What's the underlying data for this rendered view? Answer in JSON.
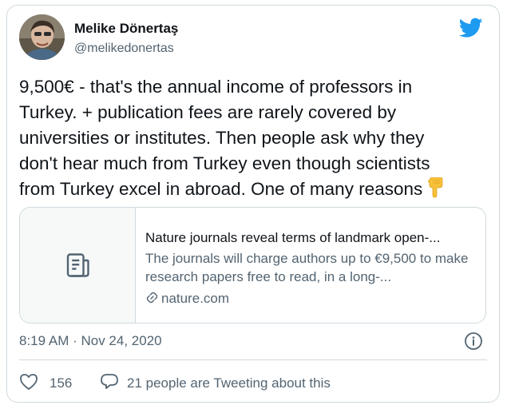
{
  "author": {
    "name": "Melike Dönertaş",
    "handle": "@melikedonertas"
  },
  "tweet": {
    "text": "9,500€ - that's the annual income of professors in\nTurkey. + publication fees are rarely covered by\nuniversities or institutes. Then people ask why they\ndon't hear much from Turkey even though scientists\nfrom Turkey excel in abroad. One of many reasons",
    "emoji": "backhand-index-pointing-down"
  },
  "link_card": {
    "title": "Nature journals reveal terms of landmark open-...",
    "description": "The journals will charge authors up to €9,500 to make research papers free to read, in a long-...",
    "domain": "nature.com"
  },
  "meta": {
    "timestamp": "8:19 AM · Nov 24, 2020"
  },
  "engagement": {
    "likes": "156",
    "tweeting": "21 people are Tweeting about this"
  },
  "colors": {
    "brand": "#1d9bf0",
    "secondary_text": "#536471",
    "border": "#cfd9de",
    "emoji": "#f7c13a"
  },
  "icons": [
    "twitter-bird-icon",
    "article-icon",
    "link-icon",
    "info-icon",
    "heart-icon",
    "reply-bubble-icon"
  ]
}
